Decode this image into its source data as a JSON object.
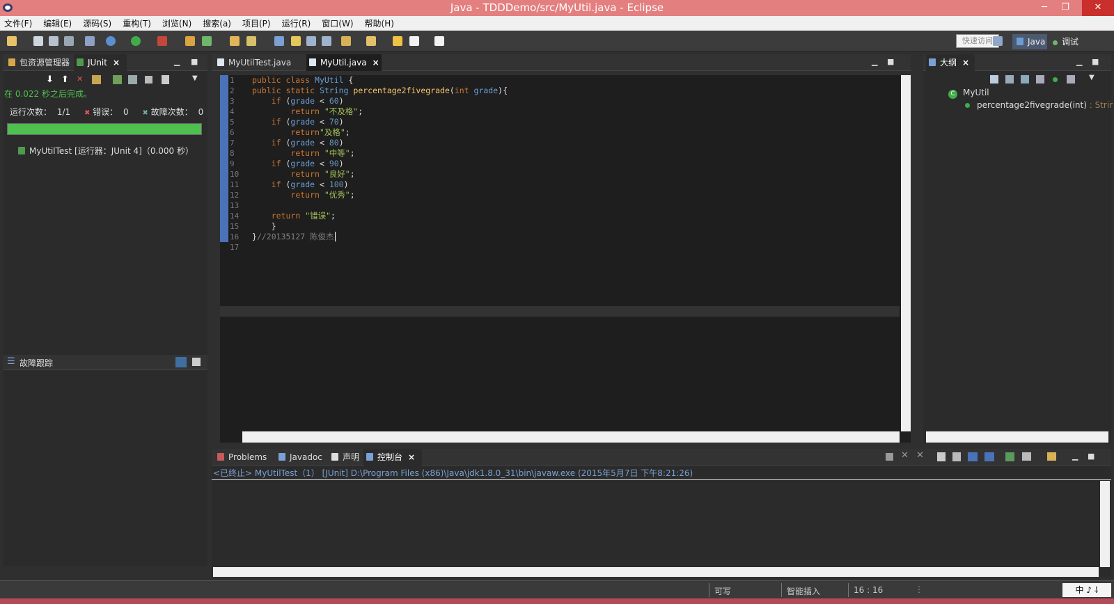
{
  "window": {
    "title": "Java - TDDDemo/src/MyUtil.java - Eclipse",
    "minimize": "─",
    "restore": "❐",
    "close": "✕"
  },
  "menu": [
    "文件(F)",
    "编辑(E)",
    "源码(S)",
    "重构(T)",
    "浏览(N)",
    "搜索(a)",
    "项目(P)",
    "运行(R)",
    "窗口(W)",
    "帮助(H)"
  ],
  "toolbar": {
    "quick_access": "快速访问",
    "perspectives": [
      "Java",
      "调试"
    ]
  },
  "left_panel": {
    "tabs": [
      "包资源管理器",
      "JUnit"
    ],
    "finished": "在 0.022 秒之后完成。",
    "runs_label": "运行次数：",
    "runs": "1/1",
    "errors_label": "错误：",
    "errors": "0",
    "failures_label": "故障次数：",
    "failures": "0",
    "progress_fraction": 1.0,
    "progress_color": "#4fbf4f",
    "tree_item": "MyUtilTest [运行器：JUnit 4]（0.000 秒）",
    "trace_title": "故障跟踪"
  },
  "editor": {
    "tabs": [
      "MyUtilTest.java",
      "MyUtil.java"
    ],
    "active_tab": "MyUtil.java",
    "line_numbers": [
      "1",
      "2",
      "3",
      "4",
      "5",
      "6",
      "7",
      "8",
      "9",
      "10",
      "11",
      "12",
      "13",
      "14",
      "15",
      "16",
      "17"
    ],
    "code": [
      [
        "kw:public class ",
        "ty:MyUtil",
        " {"
      ],
      [
        "kw:public static ",
        "ty:String ",
        "fn:percentage2fivegrade",
        "(",
        "kw:int ",
        "ty:grade",
        "){"
      ],
      [
        "    ",
        "kw:if",
        " (",
        "ty:grade",
        " < ",
        "num:60",
        ")"
      ],
      [
        "        ",
        "kw:return ",
        "str:\"不及格\"",
        ";"
      ],
      [
        "    ",
        "kw:if",
        " (",
        "ty:grade",
        " < ",
        "num:70",
        ")"
      ],
      [
        "        ",
        "kw:return",
        "str:\"及格\"",
        ";"
      ],
      [
        "    ",
        "kw:if",
        " (",
        "ty:grade",
        " < ",
        "num:80",
        ")"
      ],
      [
        "        ",
        "kw:return ",
        "str:\"中等\"",
        ";"
      ],
      [
        "    ",
        "kw:if",
        " (",
        "ty:grade",
        " < ",
        "num:90",
        ")"
      ],
      [
        "        ",
        "kw:return ",
        "str:\"良好\"",
        ";"
      ],
      [
        "    ",
        "kw:if",
        " (",
        "ty:grade",
        " < ",
        "num:100",
        ")"
      ],
      [
        "        ",
        "kw:return ",
        "str:\"优秀\"",
        ";"
      ],
      [
        ""
      ],
      [
        "    ",
        "kw:return ",
        "str:\"错误\"",
        ";"
      ],
      [
        "    }"
      ],
      [
        "}",
        "cm://20135127 陈俊杰"
      ],
      [
        ""
      ]
    ]
  },
  "outline": {
    "tab": "大纲",
    "class_name": "MyUtil",
    "method": "percentage2fivegrade(int)",
    "method_type": " : Strir"
  },
  "bottom": {
    "tabs": [
      "Problems",
      "Javadoc",
      "声明",
      "控制台"
    ],
    "active_tab": "控制台",
    "console_header": "<已终止> MyUtilTest（1） [JUnit] D:\\Program Files (x86)\\Java\\jdk1.8.0_31\\bin\\javaw.exe (2015年5月7日 下午8:21:26)"
  },
  "status": {
    "writable": "可写",
    "insert_mode": "智能插入",
    "position": "16 : 16",
    "ime": "中 ♪ ⸸"
  }
}
